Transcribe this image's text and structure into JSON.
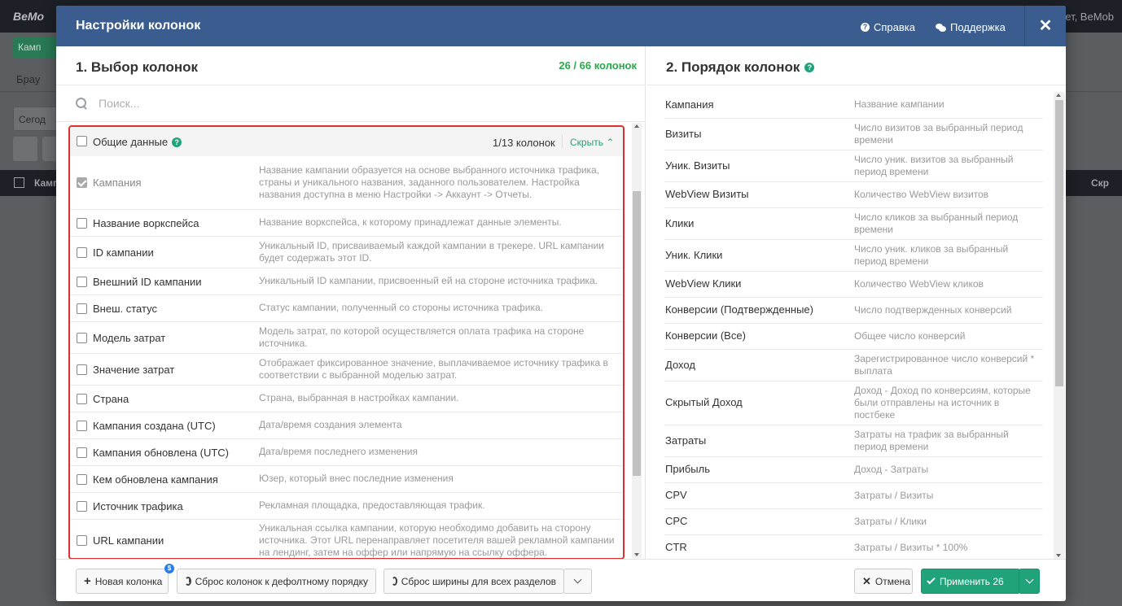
{
  "background": {
    "logo": "BeMo",
    "right_text": "ет, BeMob",
    "green_button": "Камп",
    "tab": "Брау",
    "date": "Сегод",
    "col1": "Камп",
    "col2": "Скр"
  },
  "modal": {
    "title": "Настройки колонок",
    "help": "Справка",
    "support": "Поддержка",
    "close": "✕"
  },
  "left": {
    "title": "1. Выбор колонок",
    "count": "26 / 66 колонок",
    "search_placeholder": "Поиск...",
    "group": {
      "label": "Общие данные",
      "count": "1/13 колонок",
      "hide": "Скрыть"
    },
    "rows": [
      {
        "name": "Кампания",
        "desc": "Название кампании образуется на основе выбранного источника трафика, страны и уникального названия, заданного пользователем. Настройка названия доступна в меню Настройки -> Аккаунт -> Отчеты.",
        "checked": true
      },
      {
        "name": "Название воркспейса",
        "desc": "Название воркспейса, к которому принадлежат данные элементы.",
        "checked": false
      },
      {
        "name": "ID кампании",
        "desc": "Уникальный ID, присваиваемый каждой кампании в трекере. URL кампании будет содержать этот ID.",
        "checked": false
      },
      {
        "name": "Внешний ID кампании",
        "desc": "Уникальный ID кампании, присвоенный ей на стороне источника трафика.",
        "checked": false
      },
      {
        "name": "Внеш. статус",
        "desc": "Статус кампании, полученный со стороны источника трафика.",
        "checked": false
      },
      {
        "name": "Модель затрат",
        "desc": "Модель затрат, по которой осуществляется оплата трафика на стороне источника.",
        "checked": false
      },
      {
        "name": "Значение затрат",
        "desc": "Отображает фиксированное значение, выплачиваемое источнику трафика в соответствии с выбранной моделью затрат.",
        "checked": false
      },
      {
        "name": "Страна",
        "desc": "Страна, выбранная в настройках кампании.",
        "checked": false
      },
      {
        "name": "Кампания создана (UTC)",
        "desc": "Дата/время создания элемента",
        "checked": false
      },
      {
        "name": "Кампания обновлена (UTC)",
        "desc": "Дата/время последнего изменения",
        "checked": false
      },
      {
        "name": "Кем обновлена кампания",
        "desc": "Юзер, который внес последние изменения",
        "checked": false
      },
      {
        "name": "Источник трафика",
        "desc": "Рекламная площадка, предоставляющая трафик.",
        "checked": false
      },
      {
        "name": "URL кампании",
        "desc": "Уникальная ссылка кампании, которую необходимо добавить на сторону источника. Этот URL перенаправляет посетителя вашей рекламной кампании на лендинг, затем на оффер или напрямую на ссылку оффера.",
        "checked": false
      }
    ]
  },
  "right": {
    "title": "2. Порядок колонок",
    "rows": [
      {
        "name": "Кампания",
        "desc": "Название кампании"
      },
      {
        "name": "Визиты",
        "desc": "Число визитов за выбранный период времени"
      },
      {
        "name": "Уник. Визиты",
        "desc": "Число уник. визитов за выбранный период времени"
      },
      {
        "name": "WebView Визиты",
        "desc": "Количество WebView визитов"
      },
      {
        "name": "Клики",
        "desc": "Число кликов за выбранный период времени"
      },
      {
        "name": "Уник. Клики",
        "desc": "Число уник. кликов за выбранный период времени"
      },
      {
        "name": "WebView Клики",
        "desc": "Количество WebView кликов"
      },
      {
        "name": "Конверсии (Подтвержденные)",
        "desc": "Число подтвержденных конверсий"
      },
      {
        "name": "Конверсии (Все)",
        "desc": "Общее число конверсий"
      },
      {
        "name": "Доход",
        "desc": "Зарегистрированное число конверсий * выплата"
      },
      {
        "name": "Скрытый Доход",
        "desc": "Доход - Доход по конверсиям, которые были отправлены на источник в постбеке"
      },
      {
        "name": "Затраты",
        "desc": "Затраты на трафик за выбранный период времени"
      },
      {
        "name": "Прибыль",
        "desc": "Доход - Затраты"
      },
      {
        "name": "CPV",
        "desc": "Затраты / Визиты"
      },
      {
        "name": "CPC",
        "desc": "Затраты / Клики"
      },
      {
        "name": "CTR",
        "desc": "Затраты / Визиты * 100%"
      }
    ]
  },
  "footer": {
    "new_column": "Новая колонка",
    "reset_order": "Сброс колонок к дефолтному порядку",
    "reset_width": "Сброс ширины для всех разделов",
    "cancel": "Отмена",
    "apply": "Применить 26",
    "badge": "$"
  }
}
